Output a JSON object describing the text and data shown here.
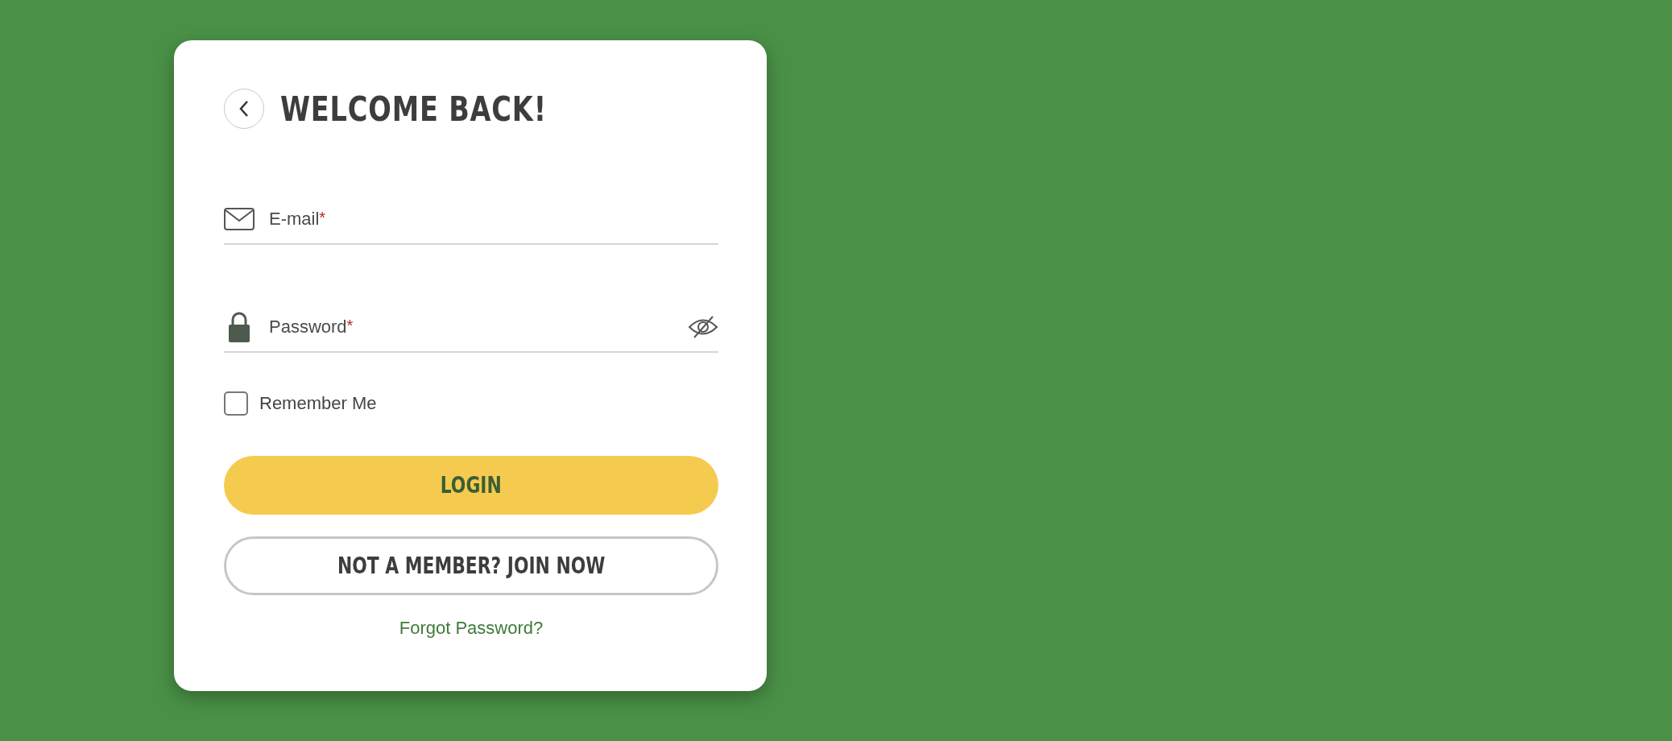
{
  "title": "WELCOME BACK!",
  "fields": [
    {
      "kind": "email",
      "placeholder": "E-mail",
      "required_mark": "*"
    },
    {
      "kind": "password",
      "placeholder": "Password",
      "required_mark": "*"
    }
  ],
  "remember": {
    "label": "Remember Me",
    "checked": false
  },
  "buttons": [
    {
      "kind": "primary",
      "label": "LOGIN"
    },
    {
      "kind": "outline",
      "label": "NOT A MEMBER? JOIN NOW"
    }
  ],
  "forgot_link": "Forgot Password?"
}
